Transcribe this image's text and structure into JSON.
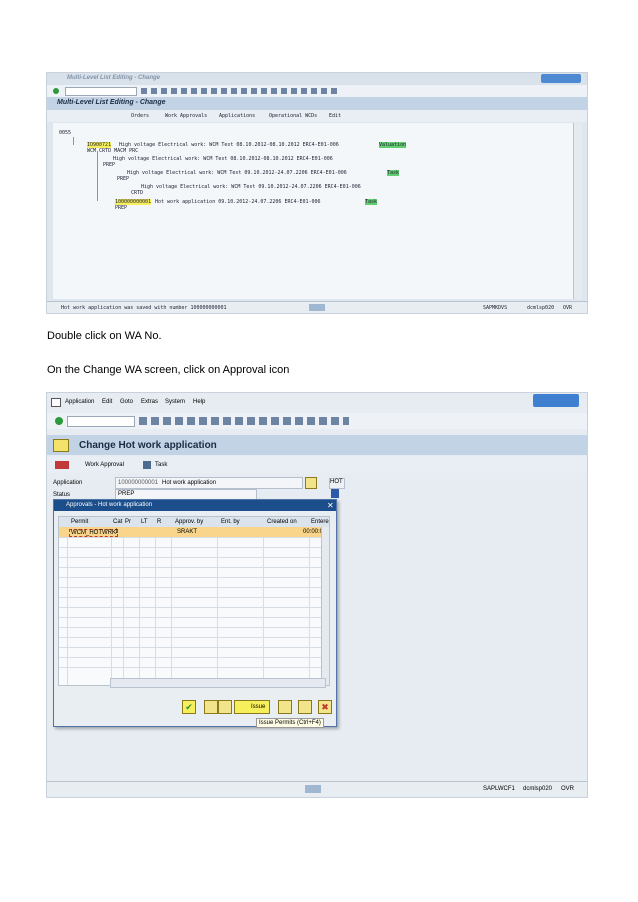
{
  "screen1": {
    "title": "Multi-Level List Editing - Change",
    "heading": "Multi-Level List Editing - Change",
    "toolbar": [
      "Orders",
      "Work Approvals",
      "Applications",
      "Operational WCDs",
      "Edit"
    ],
    "root": "0055",
    "rows": [
      {
        "id": "IO900721",
        "text": "High voltage Electrical work: WCM Test 08.10.2012-08.10.2012 ERC4-E01-006",
        "tag": "Valuation",
        "sub": "WCM    CRTD MACM PRC"
      },
      {
        "id": "",
        "text": "High voltage Electrical work: WCM Test 08.10.2012-08.10.2012 ERC4-E01-006",
        "tag": "",
        "sub": "PREP"
      },
      {
        "id": "",
        "text": "High voltage Electrical work: WCM Test 09.10.2012-24.07.2206 ERC4-E01-006",
        "tag": "Task",
        "sub": "PREP"
      },
      {
        "id": "",
        "text": "High voltage Electrical work: WCM Test 09.10.2012-24.07.2206 ERC4-E01-006",
        "tag": "",
        "sub": "CRTD"
      },
      {
        "id": "100000000001",
        "text": "Hot work application 09.10.2012-24.07.2206 ERC4-E01-006",
        "tag": "Task",
        "sub": "PREP"
      }
    ],
    "status": "Hot work application was saved with number 100000000001",
    "system": "SAPMKDVS",
    "server": "dcmlsp020",
    "mode": "OVR"
  },
  "caption1": "Double click on WA No.",
  "caption2": "On the Change WA screen, click on Approval icon",
  "screen2": {
    "menu": [
      "Application",
      "Edit",
      "Goto",
      "Extras",
      "System",
      "Help"
    ],
    "title": "Change Hot work application",
    "toolbar": [
      "Work Approval",
      "Task"
    ],
    "fields": {
      "application_label": "Application",
      "application_number": "100000000001",
      "application_text": "Hot work application",
      "application_tag": "HOT",
      "status_label": "Status",
      "status_value": "PREP"
    },
    "dialog": {
      "title": "Approvals - Hot work application",
      "columns": [
        "Permit",
        "Cat",
        "Pr",
        "LT",
        "R",
        "Approv. by",
        "Ent. by",
        "Created on",
        "Entere"
      ],
      "row": {
        "permit": "WCM_HOTWRK",
        "cat": "1",
        "approv_by": "SRAKT",
        "entered": "00:00:0"
      },
      "buttons": [
        "Issue"
      ],
      "tooltip": "Issue Permits (Ctrl+F4)"
    },
    "system": "SAPLWCF1",
    "server": "dcmlsp020",
    "mode": "OVR"
  },
  "colors": {
    "sap_blue": "#1c4e8c",
    "highlight_yellow": "#f6ef5c",
    "green_tag": "#5fcf70",
    "row_orange": "#f8d58a"
  }
}
